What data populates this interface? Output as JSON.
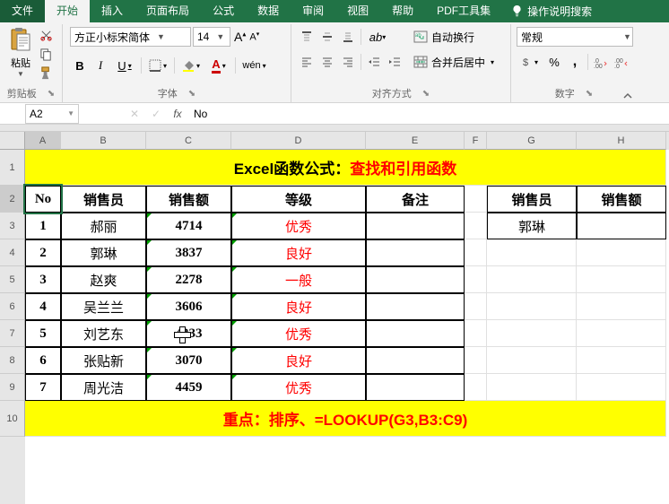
{
  "menubar": {
    "tabs": [
      "文件",
      "开始",
      "插入",
      "页面布局",
      "公式",
      "数据",
      "审阅",
      "视图",
      "帮助",
      "PDF工具集"
    ],
    "active_index": 1,
    "tell_me": "操作说明搜索"
  },
  "ribbon": {
    "clipboard": {
      "label": "剪贴板",
      "paste": "粘贴"
    },
    "font": {
      "label": "字体",
      "name": "方正小标宋简体",
      "size": "14",
      "bold": "B",
      "italic": "I",
      "underline": "U"
    },
    "alignment": {
      "label": "对齐方式",
      "wrap": "自动换行",
      "merge": "合并后居中"
    },
    "number": {
      "label": "数字",
      "format": "常规"
    }
  },
  "formula_bar": {
    "cell_ref": "A2",
    "fx": "fx",
    "value": "No"
  },
  "grid": {
    "columns": [
      "A",
      "B",
      "C",
      "D",
      "E",
      "F",
      "G",
      "H"
    ],
    "row_numbers": [
      "1",
      "2",
      "3",
      "4",
      "5",
      "6",
      "7",
      "8",
      "9",
      "10"
    ],
    "banner_black": "Excel函数公式：",
    "banner_red": "查找和引用函数",
    "headers": [
      "No",
      "销售员",
      "销售额",
      "等级",
      "备注"
    ],
    "headers2": [
      "销售员",
      "销售额"
    ],
    "data": [
      {
        "no": "1",
        "name": "郝丽",
        "amt": "4714",
        "grade": "优秀"
      },
      {
        "no": "2",
        "name": "郭琳",
        "amt": "3837",
        "grade": "良好"
      },
      {
        "no": "3",
        "name": "赵爽",
        "amt": "2278",
        "grade": "一般"
      },
      {
        "no": "4",
        "name": "吴兰兰",
        "amt": "3606",
        "grade": "良好"
      },
      {
        "no": "5",
        "name": "刘艺东",
        "amt": "4333",
        "grade": "优秀"
      },
      {
        "no": "6",
        "name": "张贴新",
        "amt": "3070",
        "grade": "良好"
      },
      {
        "no": "7",
        "name": "周光洁",
        "amt": "4459",
        "grade": "优秀"
      }
    ],
    "lookup_name": "郭琳",
    "footer_black": "重点：",
    "footer_red": "排序、=LOOKUP(G3,B3:C9)"
  }
}
